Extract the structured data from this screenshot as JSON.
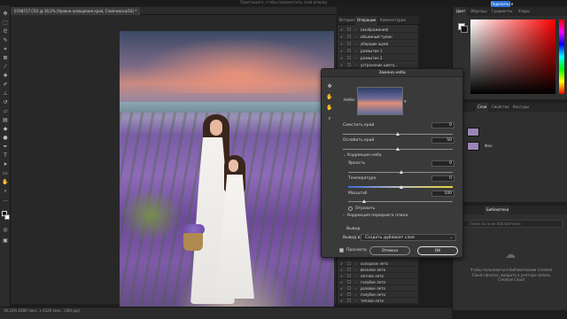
{
  "app": {
    "title_bar": "Перетащите, чтобы переместить слой вперёд",
    "share_label": "Поделиться",
    "doc_tab": "07A8717.CR2 @ 30,2% (Уровни освещения края, Слой-маска/16) *"
  },
  "actions_panel": {
    "tabs": [
      "История",
      "Операции",
      "Комментарии"
    ],
    "active_tab": 1,
    "rows_top": [
      "(изображения)",
      "объемный туман",
      "уборщик шума",
      "размытие 1",
      "размытие 2",
      "устранение цвета..."
    ],
    "rows_bottom": [
      "холодное лето",
      "веселое лето",
      "летнее лето",
      "голубое лето",
      "розовое лето",
      "голубое лето",
      "теплое лето"
    ]
  },
  "color_panel": {
    "tabs": [
      "Цвет",
      "Образцы",
      "Градиенты",
      "Узоры"
    ]
  },
  "layers_panel": {
    "tabs": [
      "Слои",
      "Свойства",
      "Контуры"
    ],
    "layers": [
      "",
      "Фон"
    ]
  },
  "library_panel": {
    "tab": "Библиотеки",
    "search_placeholder": "Поиск во всех библиотеках",
    "info": "Чтобы пользоваться библиотеками Creative Cloud Libraries, войдите в учетную запись Creative Cloud"
  },
  "dialog": {
    "title": "Замена неба",
    "sky_label": "Небо:",
    "shift_edge_label": "Сместить край",
    "shift_edge_value": "0",
    "fade_edge_label": "Ослабить край",
    "fade_edge_value": "50",
    "sky_adjust_label": "Коррекция неба",
    "brightness_label": "Яркость",
    "brightness_value": "0",
    "temperature_label": "Температура",
    "temperature_value": "0",
    "scale_label": "Масштаб",
    "scale_value": "100",
    "flip_label": "Отразить",
    "foreground_label": "Коррекция переднего плана",
    "output_label": "Вывод",
    "output_to_label": "Вывод в:",
    "output_to_value": "Создать дубликат слоя",
    "preview_label": "Просмотр",
    "cancel_label": "Отмена",
    "ok_label": "OK"
  },
  "status_bar": {
    "text": "30,24%    6480 пикс. x 4320 пикс. (300 ppi)"
  },
  "colors": {
    "accent": "#2a6fd6",
    "panel_bg": "#2f2f2f",
    "dialog_bg": "#3a3a3a"
  }
}
